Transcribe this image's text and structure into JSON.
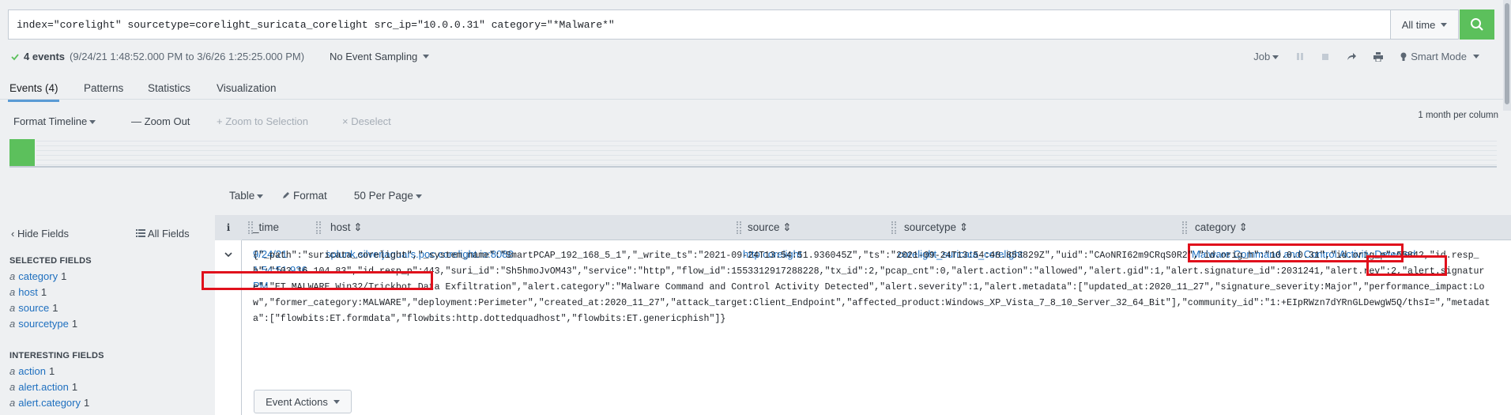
{
  "search": {
    "query": "index=\"corelight\" sourcetype=corelight_suricata_corelight  src_ip=\"10.0.0.31\" category=\"*Malware*\"",
    "time_range": "All time"
  },
  "status": {
    "count": "4 events",
    "range": "(9/24/21 1:48:52.000 PM to 3/6/26 1:25:25.000 PM)",
    "sampling": "No Event Sampling",
    "job": "Job",
    "mode": "Smart Mode"
  },
  "tabs": [
    "Events (4)",
    "Patterns",
    "Statistics",
    "Visualization"
  ],
  "timeline": {
    "format": "Format Timeline",
    "zoom_out": "Zoom Out",
    "zoom_selection": "Zoom to Selection",
    "deselect": "Deselect",
    "scale": "1 month per column"
  },
  "table_controls": {
    "table": "Table",
    "format": "Format",
    "per_page": "50 Per Page"
  },
  "sidebar": {
    "hide": "Hide Fields",
    "all": "All Fields",
    "selected_title": "SELECTED FIELDS",
    "selected": [
      {
        "name": "category",
        "count": "1"
      },
      {
        "name": "host",
        "count": "1"
      },
      {
        "name": "source",
        "count": "1"
      },
      {
        "name": "sourcetype",
        "count": "1"
      }
    ],
    "interesting_title": "INTERESTING FIELDS",
    "interesting": [
      {
        "name": "action",
        "count": "1"
      },
      {
        "name": "alert.action",
        "count": "1"
      },
      {
        "name": "alert.category",
        "count": "1"
      }
    ]
  },
  "columns": {
    "info": "i",
    "time": "_time",
    "host": "host",
    "source": "source",
    "sourcetype": "sourcetype",
    "category": "category"
  },
  "event": {
    "time_lines": [
      "9/24/21",
      "1:54:51.936",
      "PM"
    ],
    "host": "splunk.silverjaguars.poc.corelight.io:8088",
    "source": "http:corelight",
    "sourcetype": "corelight_suricata_corelight",
    "category": "Malware Command and Control Activity Detected",
    "raw_lines": [
      "{\"_path\":\"suricata_corelight\",\"_system_name\":\"SmartPCAP_192_168_5_1\",\"_write_ts\":\"2021-09-24T13:54:51.936045Z\",\"ts\":\"2021-09-24T13:54:48.853829Z\",\"uid\":\"CAoNRI62m9CRqS0R2\",\"id.orig_h\":\"10.0.0.31\",\"id.orig_p\":55842,\"id.resp_",
      "h\":\"103.16.104.83\",\"id.resp_p\":443,\"suri_id\":\"Sh5hmoJvOM43\",\"service\":\"http\",\"flow_id\":1553312917288228,\"tx_id\":2,\"pcap_cnt\":0,\"alert.action\":\"allowed\",\"alert.gid\":1,\"alert.signature_id\":2031241,\"alert.rev\":2,\"alert.signatur",
      "e\":\"ET MALWARE Win32/Trickbot Data Exfiltration\",\"alert.category\":\"Malware Command and Control Activity Detected\",\"alert.severity\":1,\"alert.metadata\":[\"updated_at:2020_11_27\",\"signature_severity:Major\",\"performance_impact:Lo",
      "w\",\"former_category:MALWARE\",\"deployment:Perimeter\",\"created_at:2020_11_27\",\"attack_target:Client_Endpoint\",\"affected_product:Windows_XP_Vista_7_8_10_Server_32_64_Bit\"],\"community_id\":\"1:+EIpRWzn7dYRnGLDewgW5Q/thsI=\",\"metadat",
      "a\":[\"flowbits:ET.formdata\",\"flowbits:http.dottedquadhost\",\"flowbits:ET.genericphish\"]}"
    ],
    "actions": "Event Actions"
  },
  "colors": {
    "accent_green": "#5cc05c",
    "link_blue": "#1e6fbf",
    "highlight_red": "#e0101c"
  }
}
